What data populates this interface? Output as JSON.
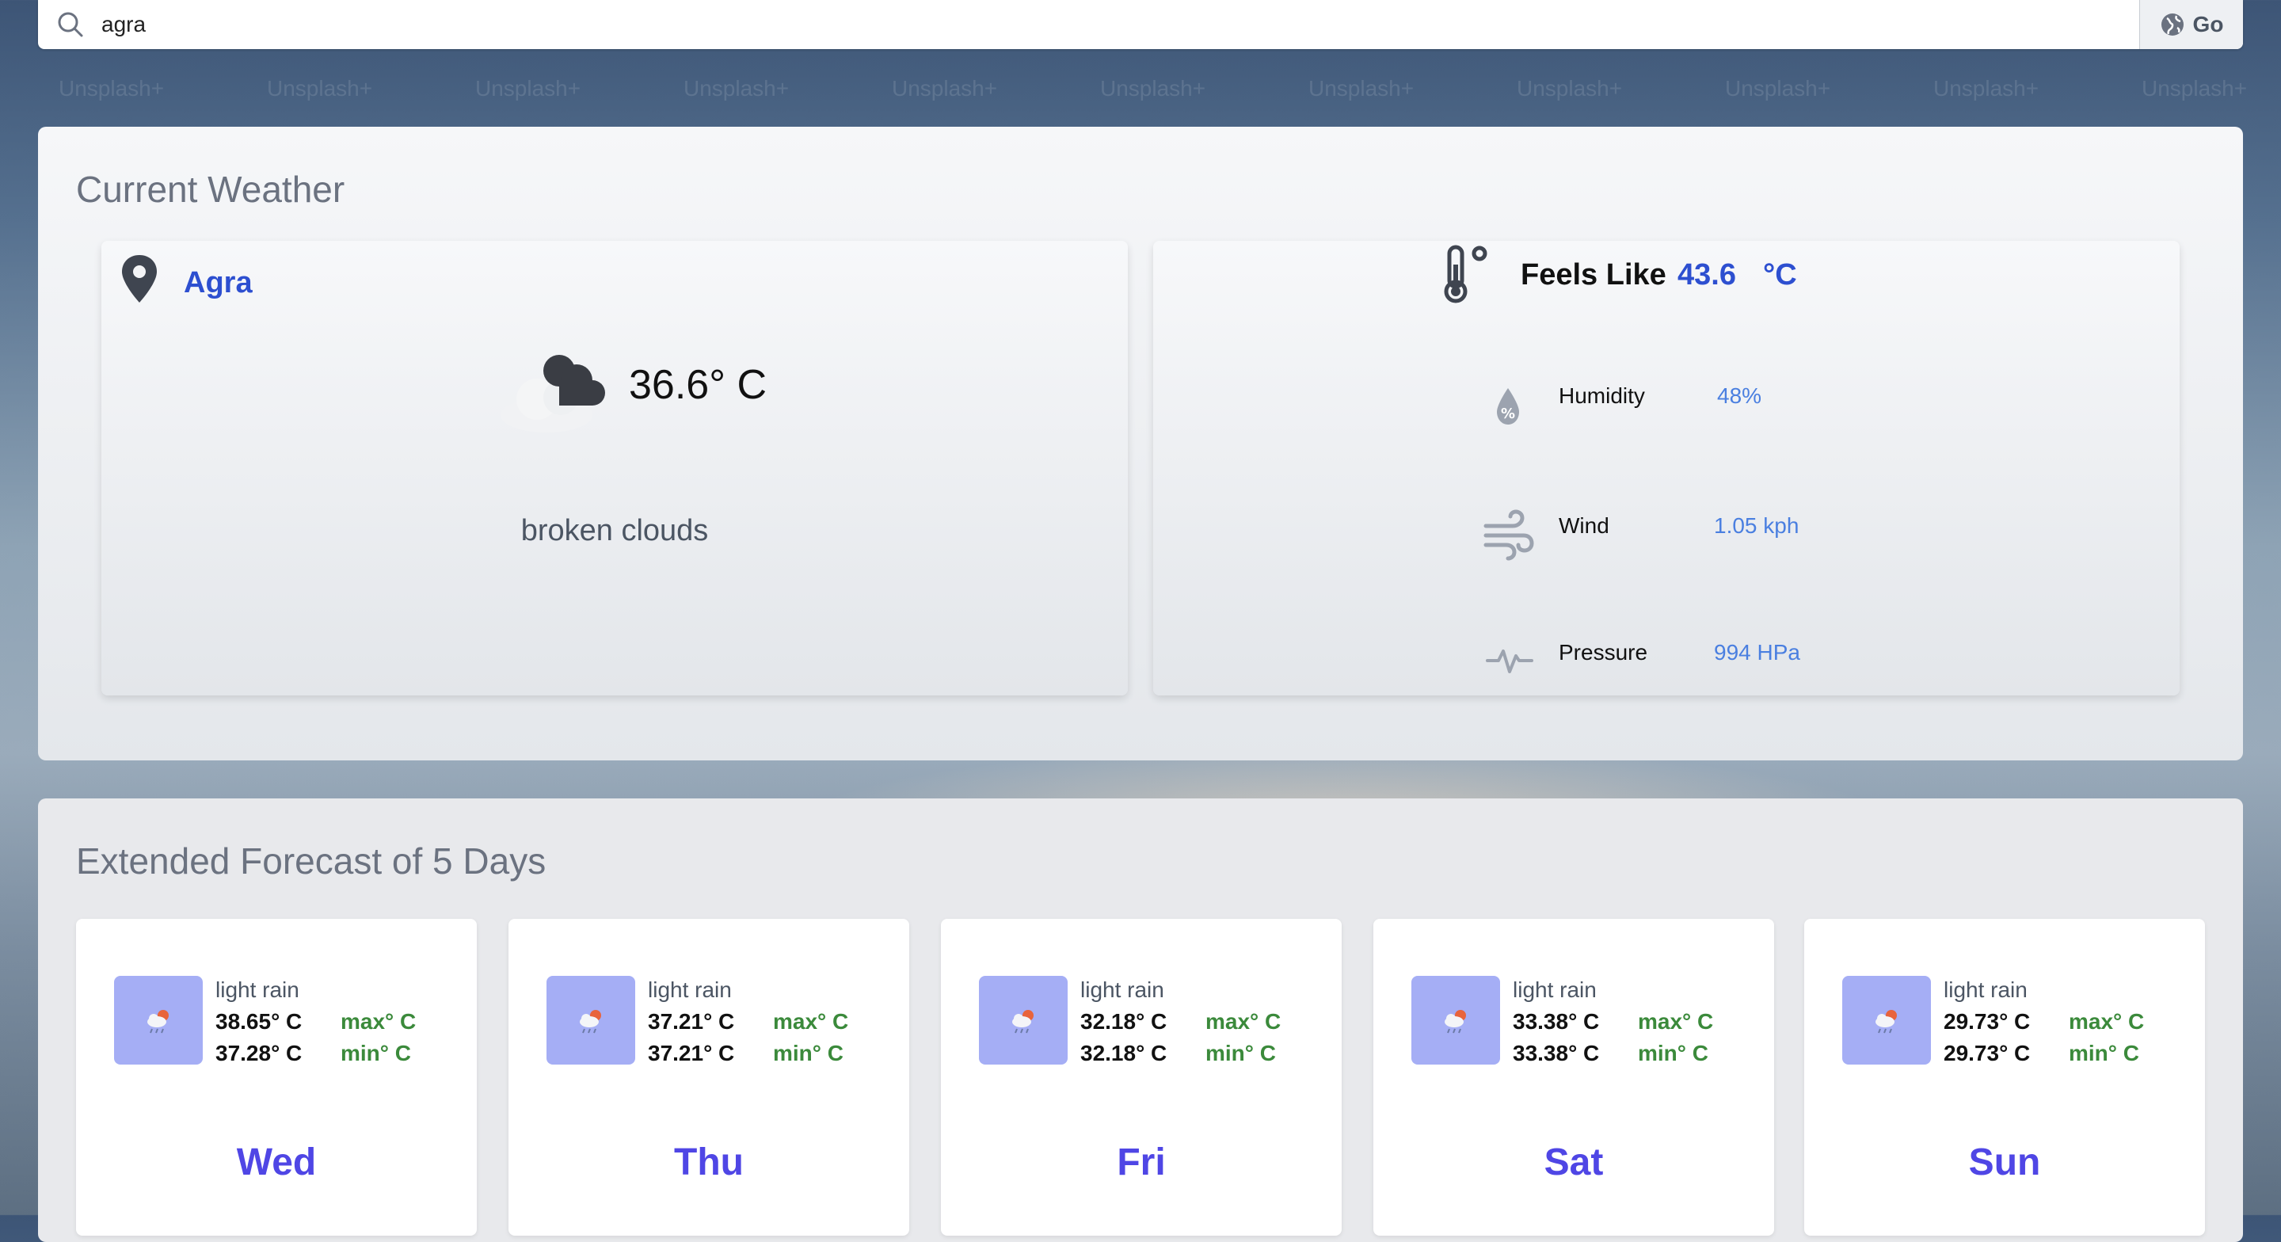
{
  "search": {
    "value": "agra",
    "go_label": "Go"
  },
  "background": {
    "watermark_text": "Unsplash+"
  },
  "current": {
    "title": "Current Weather",
    "city": "Agra",
    "temperature": "36.6° C",
    "description": "broken clouds",
    "feels_like_label": "Feels Like",
    "feels_like_value": "43.6",
    "feels_like_unit": "°C",
    "metrics": [
      {
        "label": "Humidity",
        "value": "48%",
        "icon": "humidity-drop-icon"
      },
      {
        "label": "Wind",
        "value": "1.05 kph",
        "icon": "wind-icon"
      },
      {
        "label": "Pressure",
        "value": "994 HPa",
        "icon": "pulse-icon"
      }
    ]
  },
  "forecast": {
    "title": "Extended Forecast of 5 Days",
    "max_label": "max° C",
    "min_label": "min° C",
    "days": [
      {
        "day": "Wed",
        "desc": "light rain",
        "max": "38.65° C",
        "min": "37.28° C"
      },
      {
        "day": "Thu",
        "desc": "light rain",
        "max": "37.21° C",
        "min": "37.21° C"
      },
      {
        "day": "Fri",
        "desc": "light rain",
        "max": "32.18° C",
        "min": "32.18° C"
      },
      {
        "day": "Sat",
        "desc": "light rain",
        "max": "33.38° C",
        "min": "33.38° C"
      },
      {
        "day": "Sun",
        "desc": "light rain",
        "max": "29.73° C",
        "min": "29.73° C"
      }
    ]
  },
  "colors": {
    "accent_blue": "#2d4fd0",
    "metric_blue": "#4a7fe0",
    "day_purple": "#4f46e5",
    "label_green": "#3b8a3b",
    "icon_bg": "#a5aef5"
  }
}
